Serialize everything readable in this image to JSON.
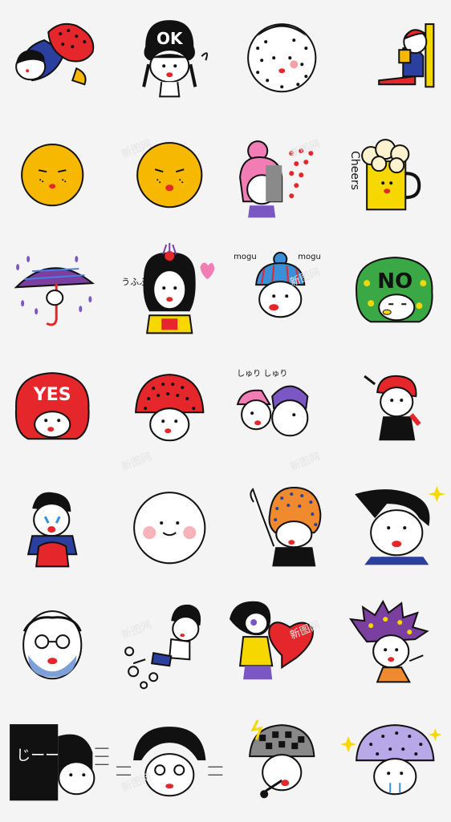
{
  "stickers": [
    {
      "name": "hug-sticker"
    },
    {
      "name": "ok-sticker",
      "text": "OK"
    },
    {
      "name": "dotted-hat-sticker"
    },
    {
      "name": "reading-sticker"
    },
    {
      "name": "yellow-face-sticker-1"
    },
    {
      "name": "yellow-face-sticker-2"
    },
    {
      "name": "pink-hair-sticker"
    },
    {
      "name": "cheers-sticker",
      "text": "Cheers"
    },
    {
      "name": "umbrella-sticker"
    },
    {
      "name": "kimono-sticker",
      "text": "うふふ"
    },
    {
      "name": "mogu-sticker",
      "text1": "mogu",
      "text2": "mogu"
    },
    {
      "name": "no-sticker",
      "text": "NO"
    },
    {
      "name": "yes-sticker",
      "text": "YES"
    },
    {
      "name": "mushroom-sticker"
    },
    {
      "name": "cheek-rub-sticker",
      "text": "しゅり しゅり"
    },
    {
      "name": "sitting-sticker"
    },
    {
      "name": "crying-sticker"
    },
    {
      "name": "round-face-sticker"
    },
    {
      "name": "waving-sticker"
    },
    {
      "name": "slick-hair-sticker"
    },
    {
      "name": "old-man-sticker"
    },
    {
      "name": "running-sticker"
    },
    {
      "name": "heart-sticker"
    },
    {
      "name": "star-hair-sticker"
    },
    {
      "name": "stare-sticker",
      "text": "じーー"
    },
    {
      "name": "bob-glasses-sticker"
    },
    {
      "name": "singing-sticker"
    },
    {
      "name": "polka-sparkle-sticker"
    }
  ],
  "watermark": "新图网",
  "colors": {
    "background": "#f4f4f4",
    "red": "#e5262b",
    "yellow": "#f6b800",
    "blue": "#2b3f9e",
    "pink": "#f27cb4",
    "green": "#3aa845",
    "purple": "#7b57c4",
    "orange": "#f08a2e"
  }
}
